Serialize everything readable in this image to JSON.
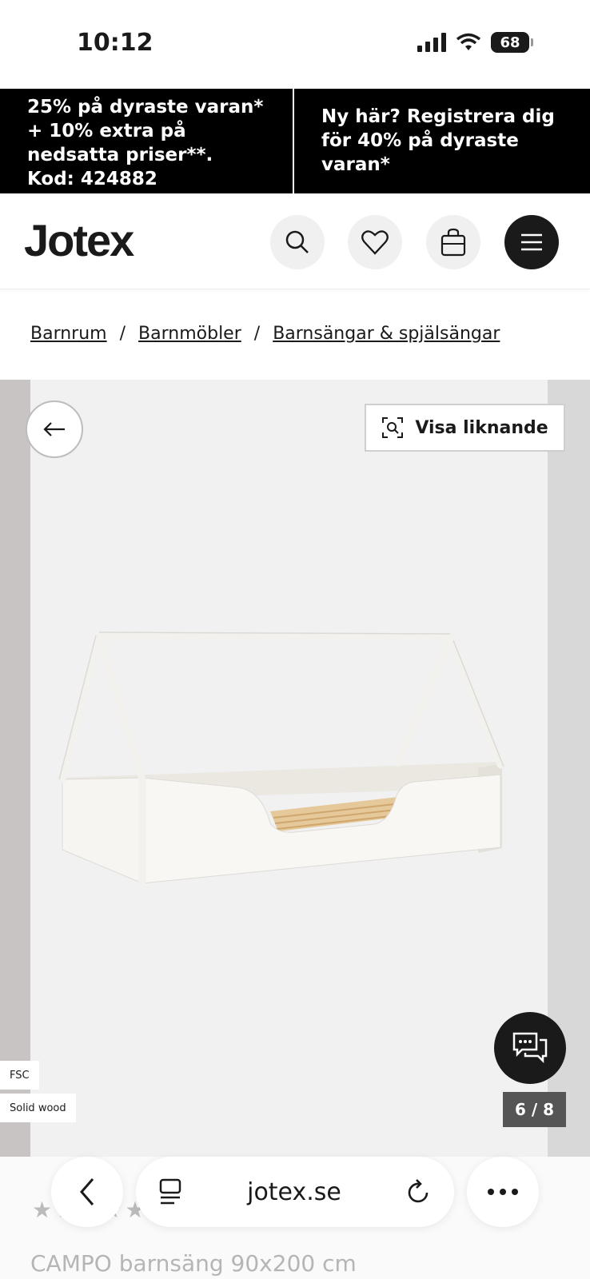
{
  "status_bar": {
    "time": "10:12",
    "battery": "68"
  },
  "promo": {
    "left": "25% på dyraste varan* + 10% extra på nedsatta priser**. Kod: 424882",
    "right": "Ny här? Registrera dig för 40% på dyraste varan*"
  },
  "header": {
    "logo": "Jotex"
  },
  "breadcrumbs": [
    "Barnrum",
    "Barnmöbler",
    "Barnsängar & spjälsängar"
  ],
  "breadcrumb_separator": "/",
  "gallery": {
    "similar_label": "Visa liknande",
    "counter": "6 / 8",
    "tags": [
      "FSC",
      "Solid wood"
    ]
  },
  "product": {
    "title": "CAMPO barnsäng 90x200 cm",
    "rating_stars": 3
  },
  "browser": {
    "url": "jotex.se"
  }
}
